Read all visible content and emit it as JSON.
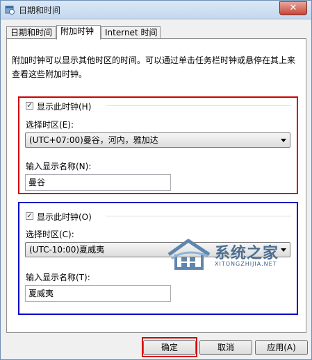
{
  "window": {
    "title": "日期和时间",
    "close_label": "✕"
  },
  "tabs": [
    {
      "label": "日期和时间",
      "active": false
    },
    {
      "label": "附加时钟",
      "active": true
    },
    {
      "label": "Internet 时间",
      "active": false
    }
  ],
  "description": "附加时钟可以显示其他时区的时间。可以通过单击任务栏时钟或悬停在其上来查看这些附加时钟。",
  "clock1": {
    "show_checked": true,
    "show_label": "显示此时钟(H)",
    "timezone_label": "选择时区(E):",
    "timezone_value": "(UTC+07:00)曼谷，河内，雅加达",
    "name_label": "输入显示名称(N):",
    "name_value": "曼谷"
  },
  "clock2": {
    "show_checked": true,
    "show_label": "显示此时钟(O)",
    "timezone_label": "选择时区(C):",
    "timezone_value": "(UTC-10:00)夏威夷",
    "name_label": "输入显示名称(T):",
    "name_value": "夏威夷"
  },
  "buttons": {
    "ok": "确定",
    "cancel": "取消",
    "apply": "应用(A)"
  },
  "watermark": {
    "main": "系统之家",
    "sub": "XITONGZHIJIA.NET"
  },
  "colors": {
    "highlight_red": "#d00000",
    "highlight_blue": "#0000c8"
  }
}
